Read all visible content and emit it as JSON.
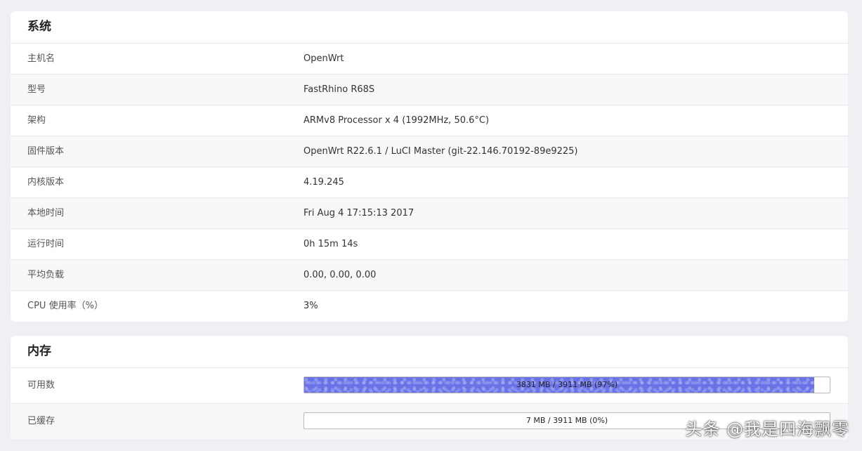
{
  "system": {
    "title": "系统",
    "rows": [
      {
        "label": "主机名",
        "value": "OpenWrt"
      },
      {
        "label": "型号",
        "value": "FastRhino R68S"
      },
      {
        "label": "架构",
        "value": "ARMv8 Processor x 4 (1992MHz, 50.6°C)"
      },
      {
        "label": "固件版本",
        "value": "OpenWrt R22.6.1 / LuCI Master (git-22.146.70192-89e9225)"
      },
      {
        "label": "内核版本",
        "value": "4.19.245"
      },
      {
        "label": "本地时间",
        "value": "Fri Aug 4 17:15:13 2017"
      },
      {
        "label": "运行时间",
        "value": "0h 15m 14s"
      },
      {
        "label": "平均负载",
        "value": "0.00, 0.00, 0.00"
      },
      {
        "label": "CPU 使用率（%）",
        "value": "3%"
      }
    ]
  },
  "memory": {
    "title": "内存",
    "rows": [
      {
        "label": "可用数",
        "text": "3831 MB / 3911 MB (97%)",
        "fraction": 0.97
      },
      {
        "label": "已缓存",
        "text": "7 MB / 3911 MB (0%)",
        "fraction": 0.0
      }
    ]
  },
  "watermark": "头条 @我是四海飘零",
  "colors": {
    "background": "#eef0f3",
    "progress_fill": "#6a73e6",
    "alt_row": "#f7f8fa"
  }
}
